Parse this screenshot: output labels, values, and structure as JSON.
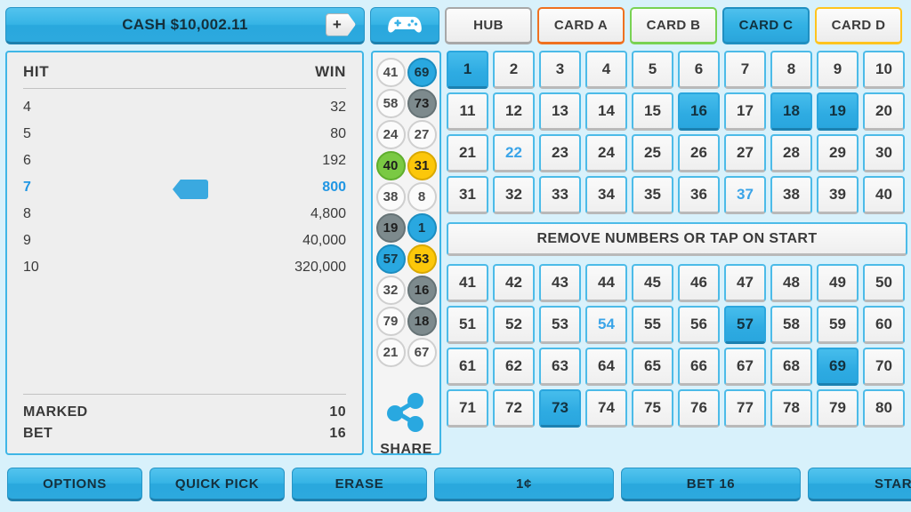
{
  "header": {
    "cash_label": "CASH $10,002.11",
    "add_cash_icon": "plus-icon",
    "gamepad_icon": "gamepad-icon",
    "tabs": [
      {
        "label": "HUB",
        "name": "hub",
        "accent": "#a8a8a8",
        "active": false
      },
      {
        "label": "CARD A",
        "name": "card-a",
        "accent": "#ef7120",
        "active": false
      },
      {
        "label": "CARD B",
        "name": "card-b",
        "accent": "#79d253",
        "active": false
      },
      {
        "label": "CARD C",
        "name": "card-c",
        "accent": "#2aa5db",
        "active": true
      },
      {
        "label": "CARD D",
        "name": "card-d",
        "accent": "#ffc41f",
        "active": false
      }
    ]
  },
  "paytable": {
    "col_hit": "HIT",
    "col_win": "WIN",
    "rows": [
      {
        "hit": "4",
        "win": "32",
        "highlight": false
      },
      {
        "hit": "5",
        "win": "80",
        "highlight": false
      },
      {
        "hit": "6",
        "win": "192",
        "highlight": false
      },
      {
        "hit": "7",
        "win": "800",
        "highlight": true
      },
      {
        "hit": "8",
        "win": "4,800",
        "highlight": false
      },
      {
        "hit": "9",
        "win": "40,000",
        "highlight": false
      },
      {
        "hit": "10",
        "win": "320,000",
        "highlight": false
      }
    ],
    "marked_label": "MARKED",
    "marked_value": "10",
    "bet_label": "BET",
    "bet_value": "16",
    "marker_icon": "pointer-marker-icon"
  },
  "draw_column": {
    "balls": [
      {
        "n": "41",
        "color": "white"
      },
      {
        "n": "69",
        "color": "blue"
      },
      {
        "n": "58",
        "color": "white"
      },
      {
        "n": "73",
        "color": "gray"
      },
      {
        "n": "24",
        "color": "white"
      },
      {
        "n": "27",
        "color": "white"
      },
      {
        "n": "40",
        "color": "green"
      },
      {
        "n": "31",
        "color": "gold"
      },
      {
        "n": "38",
        "color": "white"
      },
      {
        "n": "8",
        "color": "white"
      },
      {
        "n": "19",
        "color": "gray"
      },
      {
        "n": "1",
        "color": "blue"
      },
      {
        "n": "57",
        "color": "blue"
      },
      {
        "n": "53",
        "color": "gold"
      },
      {
        "n": "32",
        "color": "white"
      },
      {
        "n": "16",
        "color": "gray"
      },
      {
        "n": "79",
        "color": "white"
      },
      {
        "n": "18",
        "color": "gray"
      },
      {
        "n": "21",
        "color": "white"
      },
      {
        "n": "67",
        "color": "white"
      }
    ],
    "share_icon": "share-icon",
    "share_label": "SHARE"
  },
  "board": {
    "message": "REMOVE NUMBERS OR TAP ON START",
    "selected": [
      1,
      16,
      18,
      19,
      57,
      69,
      73
    ],
    "marked": [
      22,
      37,
      54
    ],
    "top_numbers": [
      1,
      2,
      3,
      4,
      5,
      6,
      7,
      8,
      9,
      10,
      11,
      12,
      13,
      14,
      15,
      16,
      17,
      18,
      19,
      20,
      21,
      22,
      23,
      24,
      25,
      26,
      27,
      28,
      29,
      30,
      31,
      32,
      33,
      34,
      35,
      36,
      37,
      38,
      39,
      40
    ],
    "bottom_numbers": [
      41,
      42,
      43,
      44,
      45,
      46,
      47,
      48,
      49,
      50,
      51,
      52,
      53,
      54,
      55,
      56,
      57,
      58,
      59,
      60,
      61,
      62,
      63,
      64,
      65,
      66,
      67,
      68,
      69,
      70,
      71,
      72,
      73,
      74,
      75,
      76,
      77,
      78,
      79,
      80
    ]
  },
  "bottom_bar": {
    "options": "OPTIONS",
    "quick_pick": "QUICK PICK",
    "erase": "ERASE",
    "denomination": "1¢",
    "bet": "BET 16",
    "start": "START"
  },
  "colors": {
    "background": "#d8f1fb",
    "accent_blue": "#29a8de",
    "panel": "#eeeeee",
    "marked_text": "#3aa4e8",
    "ball_green": "#7ac943",
    "ball_gold": "#fcc70a",
    "ball_gray": "#7d8a8d"
  }
}
